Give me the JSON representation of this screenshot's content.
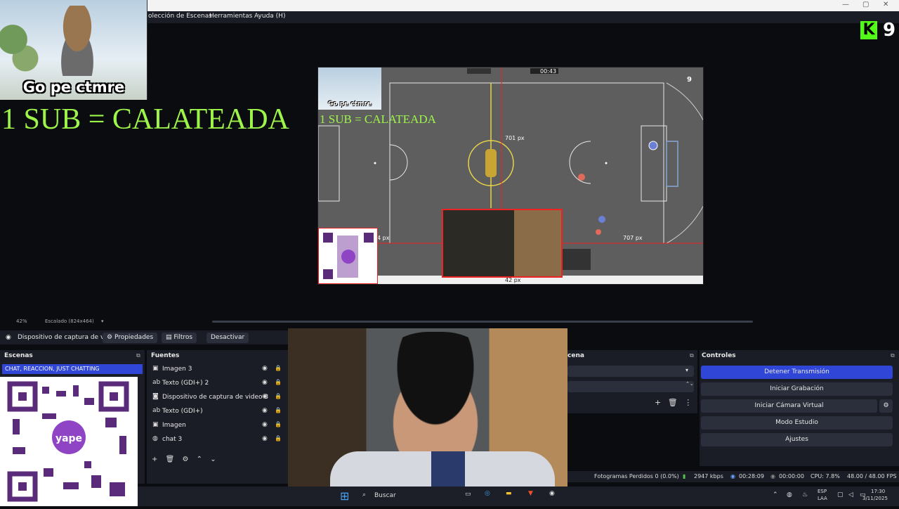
{
  "window": {
    "minimize": "—",
    "maximize": "▢",
    "close": "✕"
  },
  "menu": {
    "scene_collection": "olección de Escenas",
    "tools": "Herramientas",
    "help": "Ayuda (H)"
  },
  "overlay": {
    "meme_caption": "Go pe ctmre",
    "sub_text": "1 SUB = CALATEADA",
    "kick_letter": "K",
    "kick_count": "9"
  },
  "preview": {
    "meme_caption": "Go pe ctmre",
    "sub_text": "1 SUB = CALATEADA",
    "timer": "00:43",
    "dist_top": "701 px",
    "dist_left": "4 px",
    "dist_right": "707 px",
    "dist_bottom": "42 px",
    "kick_count": "9"
  },
  "scalebar": {
    "zoom": "42%",
    "scale_mode": "Escalado (824x464)"
  },
  "source_toolbar": {
    "selected_source": "Dispositivo de captura de v",
    "properties": "Propiedades",
    "filters": "Filtros",
    "deactivate": "Desactivar"
  },
  "scenes": {
    "title": "Escenas",
    "items": [
      "CHAT, REACCION, JUST CHATTING"
    ]
  },
  "sources": {
    "title": "Fuentes",
    "items": [
      {
        "icon": "image-icon",
        "label": "Imagen 3"
      },
      {
        "icon": "text-icon",
        "label": "Texto (GDI+) 2"
      },
      {
        "icon": "camera-icon",
        "label": "Dispositivo de captura de video 3"
      },
      {
        "icon": "text-icon",
        "label": "Texto (GDI+)"
      },
      {
        "icon": "image-icon",
        "label": "Imagen"
      },
      {
        "icon": "browser-icon",
        "label": "chat 3"
      }
    ]
  },
  "mixer": {
    "title": "cena"
  },
  "controls": {
    "title": "Controles",
    "stop_stream": "Detener Transmisión",
    "start_recording": "Iniciar Grabación",
    "virtual_camera": "Iniciar Cámara Virtual",
    "studio_mode": "Modo Estudio",
    "settings": "Ajustes"
  },
  "status": {
    "dropped_frames": "Fotogramas Perdidos 0 (0.0%)",
    "bitrate": "2947 kbps",
    "stream_time": "00:28:09",
    "rec_time": "00:00:00",
    "cpu": "CPU: 7.8%",
    "fps": "48.00 / 48.00 FPS"
  },
  "taskbar": {
    "search": "Buscar",
    "lang": "ESP",
    "lang2": "LAA",
    "time": "17:30",
    "date": "3/11/2025"
  },
  "colors": {
    "accent": "#2f46d6",
    "sub_green": "#9ef54a",
    "kick_green": "#53fc18",
    "guide_red": "#e22222"
  }
}
